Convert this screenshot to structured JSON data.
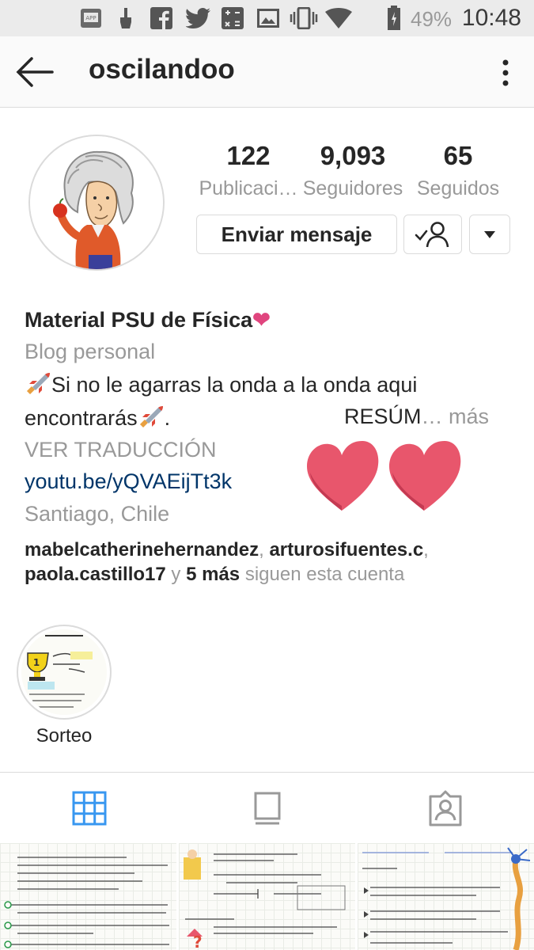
{
  "status_bar": {
    "battery_percent": "49%",
    "time": "10:48",
    "icons": [
      "gallery-icon",
      "app-store-icon",
      "brush-icon",
      "facebook-icon",
      "twitter-icon",
      "calculator-icon",
      "image-icon",
      "vibrate-icon",
      "wifi-icon",
      "battery-icon"
    ]
  },
  "header": {
    "username": "oscilandoo",
    "back_icon": "back-arrow-icon",
    "menu_icon": "more-vertical-icon"
  },
  "profile": {
    "stats": {
      "posts_count": "122",
      "posts_label": "Publicaci…",
      "followers_count": "9,093",
      "followers_label": "Seguidores",
      "following_count": "65",
      "following_label": "Seguidos"
    },
    "message_button": "Enviar mensaje",
    "follow_icon": "following-person-check-icon",
    "dropdown_icon": "caret-down-icon"
  },
  "bio": {
    "name": "Material PSU de Física",
    "name_emoji": "❤",
    "category": "Blog personal",
    "text_line1": "Si no le agarras la onda a la onda aqui",
    "text_line2_start": "encontrarás",
    "text_line2_end": ".",
    "text_truncated": "RESÚM",
    "more_label": "… más",
    "translate_label": "VER TRADUCCIÓN",
    "link": "youtu.be/yQVAEijTt3k",
    "location": "Santiago, Chile",
    "followed_by": {
      "user1": "mabelcatherinehernandez",
      "user2": "arturosifuentes.c",
      "user3": "paola.castillo17",
      "connector": "y",
      "others": "5 más",
      "suffix": "siguen esta cuenta"
    },
    "emoji_rocket": "rocket-icon"
  },
  "highlights": [
    {
      "label": "Sorteo"
    }
  ],
  "tabs": [
    {
      "name": "grid-view",
      "active": true
    },
    {
      "name": "feed-view",
      "active": false
    },
    {
      "name": "tagged-view",
      "active": false
    }
  ],
  "colors": {
    "accent_blue": "#3897f0",
    "link_blue": "#003569",
    "text_dark": "#262626",
    "text_muted": "#999999",
    "heart_pink": "#e8566c"
  }
}
